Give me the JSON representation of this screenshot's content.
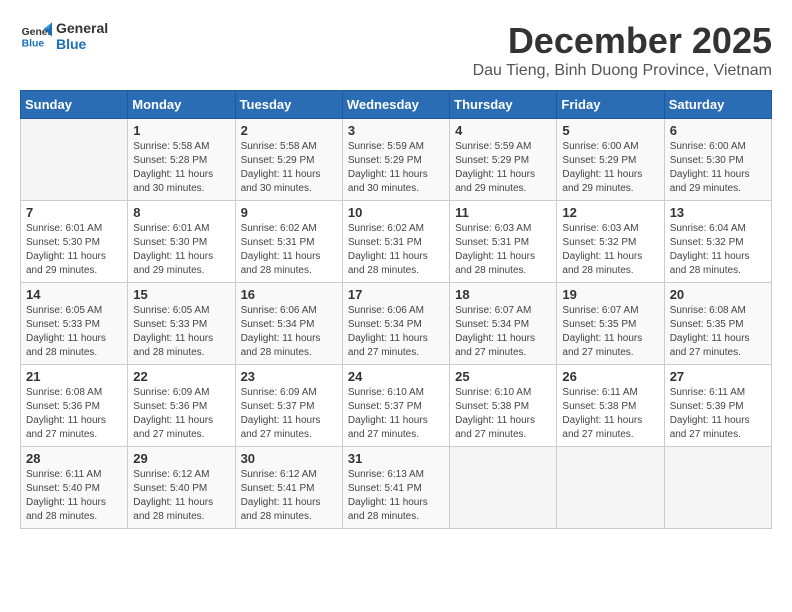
{
  "logo": {
    "line1": "General",
    "line2": "Blue"
  },
  "title": "December 2025",
  "location": "Dau Tieng, Binh Duong Province, Vietnam",
  "days_header": [
    "Sunday",
    "Monday",
    "Tuesday",
    "Wednesday",
    "Thursday",
    "Friday",
    "Saturday"
  ],
  "weeks": [
    [
      {
        "day": "",
        "info": ""
      },
      {
        "day": "1",
        "info": "Sunrise: 5:58 AM\nSunset: 5:28 PM\nDaylight: 11 hours\nand 30 minutes."
      },
      {
        "day": "2",
        "info": "Sunrise: 5:58 AM\nSunset: 5:29 PM\nDaylight: 11 hours\nand 30 minutes."
      },
      {
        "day": "3",
        "info": "Sunrise: 5:59 AM\nSunset: 5:29 PM\nDaylight: 11 hours\nand 30 minutes."
      },
      {
        "day": "4",
        "info": "Sunrise: 5:59 AM\nSunset: 5:29 PM\nDaylight: 11 hours\nand 29 minutes."
      },
      {
        "day": "5",
        "info": "Sunrise: 6:00 AM\nSunset: 5:29 PM\nDaylight: 11 hours\nand 29 minutes."
      },
      {
        "day": "6",
        "info": "Sunrise: 6:00 AM\nSunset: 5:30 PM\nDaylight: 11 hours\nand 29 minutes."
      }
    ],
    [
      {
        "day": "7",
        "info": "Sunrise: 6:01 AM\nSunset: 5:30 PM\nDaylight: 11 hours\nand 29 minutes."
      },
      {
        "day": "8",
        "info": "Sunrise: 6:01 AM\nSunset: 5:30 PM\nDaylight: 11 hours\nand 29 minutes."
      },
      {
        "day": "9",
        "info": "Sunrise: 6:02 AM\nSunset: 5:31 PM\nDaylight: 11 hours\nand 28 minutes."
      },
      {
        "day": "10",
        "info": "Sunrise: 6:02 AM\nSunset: 5:31 PM\nDaylight: 11 hours\nand 28 minutes."
      },
      {
        "day": "11",
        "info": "Sunrise: 6:03 AM\nSunset: 5:31 PM\nDaylight: 11 hours\nand 28 minutes."
      },
      {
        "day": "12",
        "info": "Sunrise: 6:03 AM\nSunset: 5:32 PM\nDaylight: 11 hours\nand 28 minutes."
      },
      {
        "day": "13",
        "info": "Sunrise: 6:04 AM\nSunset: 5:32 PM\nDaylight: 11 hours\nand 28 minutes."
      }
    ],
    [
      {
        "day": "14",
        "info": "Sunrise: 6:05 AM\nSunset: 5:33 PM\nDaylight: 11 hours\nand 28 minutes."
      },
      {
        "day": "15",
        "info": "Sunrise: 6:05 AM\nSunset: 5:33 PM\nDaylight: 11 hours\nand 28 minutes."
      },
      {
        "day": "16",
        "info": "Sunrise: 6:06 AM\nSunset: 5:34 PM\nDaylight: 11 hours\nand 28 minutes."
      },
      {
        "day": "17",
        "info": "Sunrise: 6:06 AM\nSunset: 5:34 PM\nDaylight: 11 hours\nand 27 minutes."
      },
      {
        "day": "18",
        "info": "Sunrise: 6:07 AM\nSunset: 5:34 PM\nDaylight: 11 hours\nand 27 minutes."
      },
      {
        "day": "19",
        "info": "Sunrise: 6:07 AM\nSunset: 5:35 PM\nDaylight: 11 hours\nand 27 minutes."
      },
      {
        "day": "20",
        "info": "Sunrise: 6:08 AM\nSunset: 5:35 PM\nDaylight: 11 hours\nand 27 minutes."
      }
    ],
    [
      {
        "day": "21",
        "info": "Sunrise: 6:08 AM\nSunset: 5:36 PM\nDaylight: 11 hours\nand 27 minutes."
      },
      {
        "day": "22",
        "info": "Sunrise: 6:09 AM\nSunset: 5:36 PM\nDaylight: 11 hours\nand 27 minutes."
      },
      {
        "day": "23",
        "info": "Sunrise: 6:09 AM\nSunset: 5:37 PM\nDaylight: 11 hours\nand 27 minutes."
      },
      {
        "day": "24",
        "info": "Sunrise: 6:10 AM\nSunset: 5:37 PM\nDaylight: 11 hours\nand 27 minutes."
      },
      {
        "day": "25",
        "info": "Sunrise: 6:10 AM\nSunset: 5:38 PM\nDaylight: 11 hours\nand 27 minutes."
      },
      {
        "day": "26",
        "info": "Sunrise: 6:11 AM\nSunset: 5:38 PM\nDaylight: 11 hours\nand 27 minutes."
      },
      {
        "day": "27",
        "info": "Sunrise: 6:11 AM\nSunset: 5:39 PM\nDaylight: 11 hours\nand 27 minutes."
      }
    ],
    [
      {
        "day": "28",
        "info": "Sunrise: 6:11 AM\nSunset: 5:40 PM\nDaylight: 11 hours\nand 28 minutes."
      },
      {
        "day": "29",
        "info": "Sunrise: 6:12 AM\nSunset: 5:40 PM\nDaylight: 11 hours\nand 28 minutes."
      },
      {
        "day": "30",
        "info": "Sunrise: 6:12 AM\nSunset: 5:41 PM\nDaylight: 11 hours\nand 28 minutes."
      },
      {
        "day": "31",
        "info": "Sunrise: 6:13 AM\nSunset: 5:41 PM\nDaylight: 11 hours\nand 28 minutes."
      },
      {
        "day": "",
        "info": ""
      },
      {
        "day": "",
        "info": ""
      },
      {
        "day": "",
        "info": ""
      }
    ]
  ]
}
